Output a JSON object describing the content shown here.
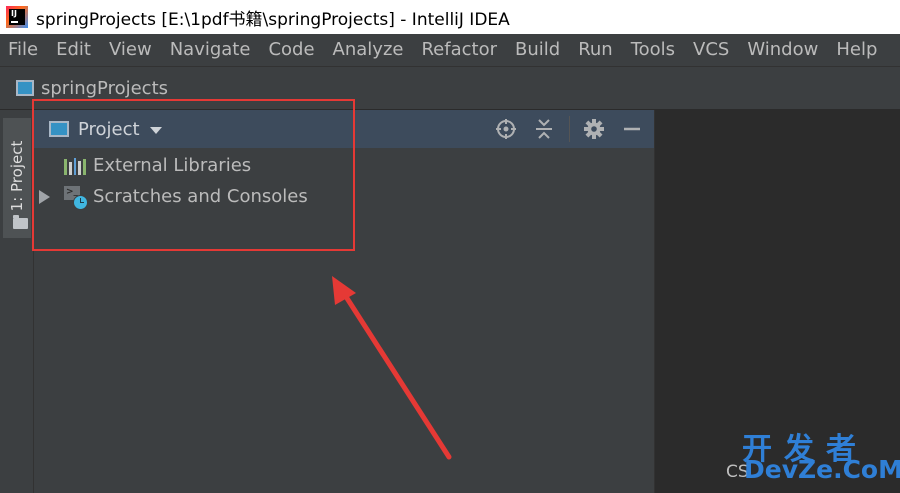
{
  "window": {
    "title": "springProjects [E:\\1pdf书籍\\springProjects] - IntelliJ IDEA",
    "app_icon_text": "IJ"
  },
  "menu": {
    "items": [
      "File",
      "Edit",
      "View",
      "Navigate",
      "Code",
      "Analyze",
      "Refactor",
      "Build",
      "Run",
      "Tools",
      "VCS",
      "Window",
      "Help"
    ]
  },
  "navbar": {
    "project_name": "springProjects"
  },
  "tool_strip": {
    "project_tab_label": "1: Project"
  },
  "project_panel": {
    "title": "Project",
    "tools": {
      "locate_icon": "crosshair-icon",
      "collapse_icon": "collapse-all-icon",
      "settings_icon": "gear-icon",
      "hide_icon": "minimize-icon"
    },
    "tree": [
      {
        "label": "External Libraries",
        "icon": "library-icon",
        "expandable": false
      },
      {
        "label": "Scratches and Consoles",
        "icon": "scratch-icon",
        "expandable": true
      }
    ]
  },
  "annotation": {
    "box_color": "#e53935",
    "arrow_color": "#e53935"
  },
  "watermark": {
    "cn_text": "开发者",
    "csdn_text": "CS",
    "devze_text": "DevZe.CoM"
  }
}
